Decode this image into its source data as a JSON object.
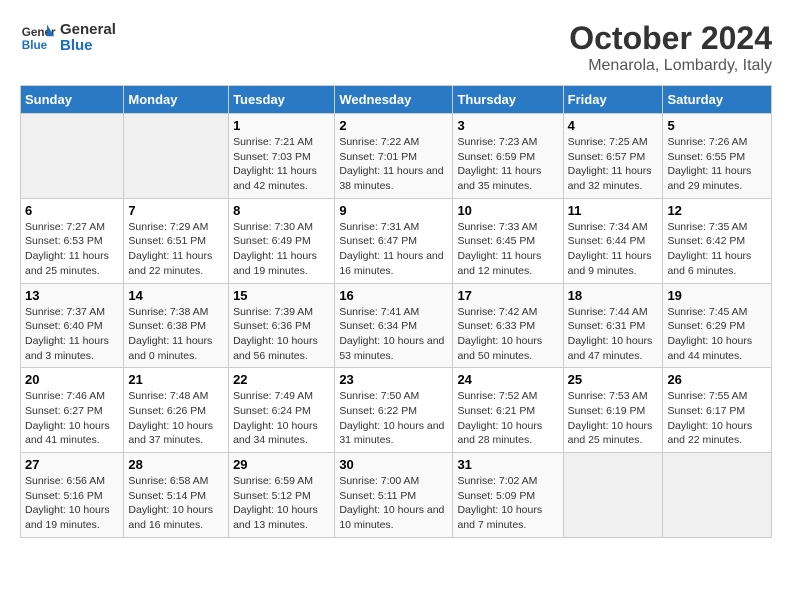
{
  "header": {
    "logo_line1": "General",
    "logo_line2": "Blue",
    "main_title": "October 2024",
    "subtitle": "Menarola, Lombardy, Italy"
  },
  "days_of_week": [
    "Sunday",
    "Monday",
    "Tuesday",
    "Wednesday",
    "Thursday",
    "Friday",
    "Saturday"
  ],
  "weeks": [
    [
      {
        "num": "",
        "sunrise": "",
        "sunset": "",
        "daylight": ""
      },
      {
        "num": "",
        "sunrise": "",
        "sunset": "",
        "daylight": ""
      },
      {
        "num": "1",
        "sunrise": "Sunrise: 7:21 AM",
        "sunset": "Sunset: 7:03 PM",
        "daylight": "Daylight: 11 hours and 42 minutes."
      },
      {
        "num": "2",
        "sunrise": "Sunrise: 7:22 AM",
        "sunset": "Sunset: 7:01 PM",
        "daylight": "Daylight: 11 hours and 38 minutes."
      },
      {
        "num": "3",
        "sunrise": "Sunrise: 7:23 AM",
        "sunset": "Sunset: 6:59 PM",
        "daylight": "Daylight: 11 hours and 35 minutes."
      },
      {
        "num": "4",
        "sunrise": "Sunrise: 7:25 AM",
        "sunset": "Sunset: 6:57 PM",
        "daylight": "Daylight: 11 hours and 32 minutes."
      },
      {
        "num": "5",
        "sunrise": "Sunrise: 7:26 AM",
        "sunset": "Sunset: 6:55 PM",
        "daylight": "Daylight: 11 hours and 29 minutes."
      }
    ],
    [
      {
        "num": "6",
        "sunrise": "Sunrise: 7:27 AM",
        "sunset": "Sunset: 6:53 PM",
        "daylight": "Daylight: 11 hours and 25 minutes."
      },
      {
        "num": "7",
        "sunrise": "Sunrise: 7:29 AM",
        "sunset": "Sunset: 6:51 PM",
        "daylight": "Daylight: 11 hours and 22 minutes."
      },
      {
        "num": "8",
        "sunrise": "Sunrise: 7:30 AM",
        "sunset": "Sunset: 6:49 PM",
        "daylight": "Daylight: 11 hours and 19 minutes."
      },
      {
        "num": "9",
        "sunrise": "Sunrise: 7:31 AM",
        "sunset": "Sunset: 6:47 PM",
        "daylight": "Daylight: 11 hours and 16 minutes."
      },
      {
        "num": "10",
        "sunrise": "Sunrise: 7:33 AM",
        "sunset": "Sunset: 6:45 PM",
        "daylight": "Daylight: 11 hours and 12 minutes."
      },
      {
        "num": "11",
        "sunrise": "Sunrise: 7:34 AM",
        "sunset": "Sunset: 6:44 PM",
        "daylight": "Daylight: 11 hours and 9 minutes."
      },
      {
        "num": "12",
        "sunrise": "Sunrise: 7:35 AM",
        "sunset": "Sunset: 6:42 PM",
        "daylight": "Daylight: 11 hours and 6 minutes."
      }
    ],
    [
      {
        "num": "13",
        "sunrise": "Sunrise: 7:37 AM",
        "sunset": "Sunset: 6:40 PM",
        "daylight": "Daylight: 11 hours and 3 minutes."
      },
      {
        "num": "14",
        "sunrise": "Sunrise: 7:38 AM",
        "sunset": "Sunset: 6:38 PM",
        "daylight": "Daylight: 11 hours and 0 minutes."
      },
      {
        "num": "15",
        "sunrise": "Sunrise: 7:39 AM",
        "sunset": "Sunset: 6:36 PM",
        "daylight": "Daylight: 10 hours and 56 minutes."
      },
      {
        "num": "16",
        "sunrise": "Sunrise: 7:41 AM",
        "sunset": "Sunset: 6:34 PM",
        "daylight": "Daylight: 10 hours and 53 minutes."
      },
      {
        "num": "17",
        "sunrise": "Sunrise: 7:42 AM",
        "sunset": "Sunset: 6:33 PM",
        "daylight": "Daylight: 10 hours and 50 minutes."
      },
      {
        "num": "18",
        "sunrise": "Sunrise: 7:44 AM",
        "sunset": "Sunset: 6:31 PM",
        "daylight": "Daylight: 10 hours and 47 minutes."
      },
      {
        "num": "19",
        "sunrise": "Sunrise: 7:45 AM",
        "sunset": "Sunset: 6:29 PM",
        "daylight": "Daylight: 10 hours and 44 minutes."
      }
    ],
    [
      {
        "num": "20",
        "sunrise": "Sunrise: 7:46 AM",
        "sunset": "Sunset: 6:27 PM",
        "daylight": "Daylight: 10 hours and 41 minutes."
      },
      {
        "num": "21",
        "sunrise": "Sunrise: 7:48 AM",
        "sunset": "Sunset: 6:26 PM",
        "daylight": "Daylight: 10 hours and 37 minutes."
      },
      {
        "num": "22",
        "sunrise": "Sunrise: 7:49 AM",
        "sunset": "Sunset: 6:24 PM",
        "daylight": "Daylight: 10 hours and 34 minutes."
      },
      {
        "num": "23",
        "sunrise": "Sunrise: 7:50 AM",
        "sunset": "Sunset: 6:22 PM",
        "daylight": "Daylight: 10 hours and 31 minutes."
      },
      {
        "num": "24",
        "sunrise": "Sunrise: 7:52 AM",
        "sunset": "Sunset: 6:21 PM",
        "daylight": "Daylight: 10 hours and 28 minutes."
      },
      {
        "num": "25",
        "sunrise": "Sunrise: 7:53 AM",
        "sunset": "Sunset: 6:19 PM",
        "daylight": "Daylight: 10 hours and 25 minutes."
      },
      {
        "num": "26",
        "sunrise": "Sunrise: 7:55 AM",
        "sunset": "Sunset: 6:17 PM",
        "daylight": "Daylight: 10 hours and 22 minutes."
      }
    ],
    [
      {
        "num": "27",
        "sunrise": "Sunrise: 6:56 AM",
        "sunset": "Sunset: 5:16 PM",
        "daylight": "Daylight: 10 hours and 19 minutes."
      },
      {
        "num": "28",
        "sunrise": "Sunrise: 6:58 AM",
        "sunset": "Sunset: 5:14 PM",
        "daylight": "Daylight: 10 hours and 16 minutes."
      },
      {
        "num": "29",
        "sunrise": "Sunrise: 6:59 AM",
        "sunset": "Sunset: 5:12 PM",
        "daylight": "Daylight: 10 hours and 13 minutes."
      },
      {
        "num": "30",
        "sunrise": "Sunrise: 7:00 AM",
        "sunset": "Sunset: 5:11 PM",
        "daylight": "Daylight: 10 hours and 10 minutes."
      },
      {
        "num": "31",
        "sunrise": "Sunrise: 7:02 AM",
        "sunset": "Sunset: 5:09 PM",
        "daylight": "Daylight: 10 hours and 7 minutes."
      },
      {
        "num": "",
        "sunrise": "",
        "sunset": "",
        "daylight": ""
      },
      {
        "num": "",
        "sunrise": "",
        "sunset": "",
        "daylight": ""
      }
    ]
  ]
}
